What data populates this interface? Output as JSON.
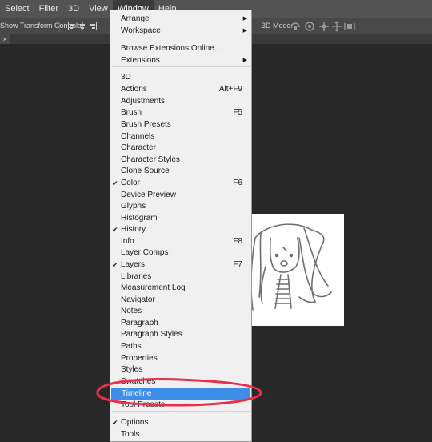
{
  "menubar": {
    "items": [
      "Select",
      "Filter",
      "3D",
      "View",
      "Window",
      "Help"
    ]
  },
  "options_bar": {
    "label": "Show Transform Controls",
    "mode_label": "3D Mode:"
  },
  "tab": {
    "close": "×"
  },
  "menu": {
    "items": [
      {
        "label": "Arrange",
        "submenu": true
      },
      {
        "label": "Workspace",
        "submenu": true
      },
      {
        "label": "Browse Extensions Online..."
      },
      {
        "label": "Extensions",
        "submenu": true
      },
      {
        "label": "3D"
      },
      {
        "label": "Actions",
        "shortcut": "Alt+F9"
      },
      {
        "label": "Adjustments"
      },
      {
        "label": "Brush",
        "shortcut": "F5"
      },
      {
        "label": "Brush Presets"
      },
      {
        "label": "Channels"
      },
      {
        "label": "Character"
      },
      {
        "label": "Character Styles"
      },
      {
        "label": "Clone Source"
      },
      {
        "label": "Color",
        "shortcut": "F6",
        "checked": true
      },
      {
        "label": "Device Preview"
      },
      {
        "label": "Glyphs"
      },
      {
        "label": "Histogram"
      },
      {
        "label": "History",
        "checked": true
      },
      {
        "label": "Info",
        "shortcut": "F8"
      },
      {
        "label": "Layer Comps"
      },
      {
        "label": "Layers",
        "shortcut": "F7",
        "checked": true
      },
      {
        "label": "Libraries"
      },
      {
        "label": "Measurement Log"
      },
      {
        "label": "Navigator"
      },
      {
        "label": "Notes"
      },
      {
        "label": "Paragraph"
      },
      {
        "label": "Paragraph Styles"
      },
      {
        "label": "Paths"
      },
      {
        "label": "Properties"
      },
      {
        "label": "Styles"
      },
      {
        "label": "Swatches"
      },
      {
        "label": "Timeline",
        "highlighted": true
      },
      {
        "label": "Tool Presets"
      },
      {
        "label": "Options",
        "checked": true
      },
      {
        "label": "Tools"
      }
    ],
    "checkmark": "✔",
    "arrow": "▶"
  },
  "colors": {
    "highlight": "#3d8ee8",
    "annotation": "#e8304a"
  }
}
